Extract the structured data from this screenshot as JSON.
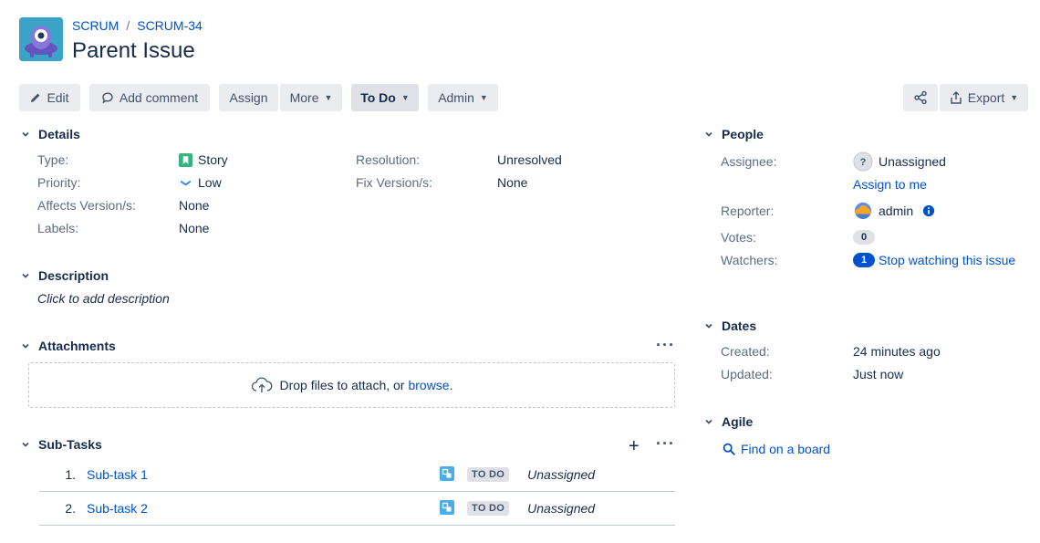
{
  "breadcrumb": {
    "project": "SCRUM",
    "separator": "/",
    "issue_key": "SCRUM-34"
  },
  "title": "Parent Issue",
  "toolbar": {
    "edit": "Edit",
    "add_comment": "Add comment",
    "assign": "Assign",
    "more": "More",
    "status": "To Do",
    "admin": "Admin",
    "export": "Export"
  },
  "details": {
    "heading": "Details",
    "type_label": "Type:",
    "type_value": "Story",
    "priority_label": "Priority:",
    "priority_value": "Low",
    "affects_label": "Affects Version/s:",
    "affects_value": "None",
    "labels_label": "Labels:",
    "labels_value": "None",
    "resolution_label": "Resolution:",
    "resolution_value": "Unresolved",
    "fix_label": "Fix Version/s:",
    "fix_value": "None"
  },
  "description": {
    "heading": "Description",
    "placeholder": "Click to add description"
  },
  "attachments": {
    "heading": "Attachments",
    "drop_text": "Drop files to attach, or",
    "browse": "browse."
  },
  "subtasks": {
    "heading": "Sub-Tasks",
    "rows": [
      {
        "num": "1.",
        "summary": "Sub-task 1",
        "status": "TO DO",
        "assignee": "Unassigned"
      },
      {
        "num": "2.",
        "summary": "Sub-task 2",
        "status": "TO DO",
        "assignee": "Unassigned"
      }
    ]
  },
  "people": {
    "heading": "People",
    "assignee_label": "Assignee:",
    "assignee_value": "Unassigned",
    "assign_to_me": "Assign to me",
    "reporter_label": "Reporter:",
    "reporter_value": "admin",
    "votes_label": "Votes:",
    "votes_count": "0",
    "watchers_label": "Watchers:",
    "watchers_count": "1",
    "stop_watching": "Stop watching this issue"
  },
  "dates": {
    "heading": "Dates",
    "created_label": "Created:",
    "created_value": "24 minutes ago",
    "updated_label": "Updated:",
    "updated_value": "Just now"
  },
  "agile": {
    "heading": "Agile",
    "find_on_board": "Find on a board"
  },
  "colors": {
    "link": "#0052cc",
    "story_green": "#36b37e",
    "priority_blue": "#2684ff",
    "button_bg": "#ebecf0"
  }
}
